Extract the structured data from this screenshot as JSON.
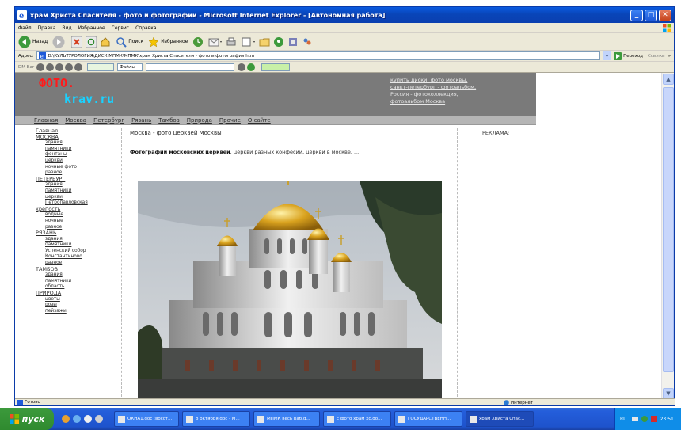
{
  "window": {
    "title": "храм Христа Спасителя - фото и фотографии - Microsoft Internet Explorer - [Автономная работа]",
    "minimize": "_",
    "maximize": "□",
    "close": "✕"
  },
  "menu": [
    "Файл",
    "Правка",
    "Вид",
    "Избранное",
    "Сервис",
    "Справка"
  ],
  "toolbar": {
    "back": "Назад",
    "search": "Поиск",
    "favorites": "Избранное"
  },
  "address": {
    "label": "Адрес:",
    "value": "D:\\КУЛЬТУРОЛОГИЯ\\ДИСК МПМК\\МПМК\\храм Христа Спасителя - фото и фотографии.htm",
    "go": "Переход",
    "links": "Ссылки"
  },
  "linksbar": {
    "label": "DM Bar",
    "files": "Файлы"
  },
  "status": {
    "left": "Готово",
    "zone": "Интернет"
  },
  "site": {
    "logo_top": "ФОТО.",
    "logo_bottom": "krav.ru",
    "header_links": [
      "купить диски: фото москвы,",
      "санкт-петербург - фотоальбом,",
      "Россия - фотоколлекция,",
      "фотоальбом Москва"
    ],
    "nav": [
      "Главная",
      "Москва",
      "Петербург",
      "Рязань",
      "Тамбов",
      "Природа",
      "Прочие",
      "О сайте"
    ],
    "sidebar": [
      {
        "t": "sec",
        "label": "Главная"
      },
      {
        "t": "sec",
        "label": "МОСКВА"
      },
      {
        "t": "sub",
        "label": "здания"
      },
      {
        "t": "sub",
        "label": "памятники"
      },
      {
        "t": "sub",
        "label": "фонтаны"
      },
      {
        "t": "sub",
        "label": "церкви"
      },
      {
        "t": "sub",
        "label": "ночные фото"
      },
      {
        "t": "sub",
        "label": "разное"
      },
      {
        "t": "sec",
        "label": "ПЕТЕРБУРГ"
      },
      {
        "t": "sub",
        "label": "здания"
      },
      {
        "t": "sub",
        "label": "памятники"
      },
      {
        "t": "sub",
        "label": "церкви"
      },
      {
        "t": "sub",
        "label": "Петропавловская"
      },
      {
        "t": "sec",
        "label": "крепость"
      },
      {
        "t": "sub",
        "label": "водные"
      },
      {
        "t": "sub",
        "label": "ночные"
      },
      {
        "t": "sub",
        "label": "разное"
      },
      {
        "t": "sec",
        "label": "РЯЗАНЬ"
      },
      {
        "t": "sub",
        "label": "здания"
      },
      {
        "t": "sub",
        "label": "памятники"
      },
      {
        "t": "sub",
        "label": "Успенский собор"
      },
      {
        "t": "sub",
        "label": "Константиново"
      },
      {
        "t": "sub",
        "label": "разное"
      },
      {
        "t": "sec",
        "label": "ТАМБОВ"
      },
      {
        "t": "sub",
        "label": "здания"
      },
      {
        "t": "sub",
        "label": "памятники"
      },
      {
        "t": "sub",
        "label": "область"
      },
      {
        "t": "sec",
        "label": "ПРИРОДА"
      },
      {
        "t": "sub",
        "label": "цветы"
      },
      {
        "t": "sub",
        "label": "розы"
      },
      {
        "t": "sub",
        "label": "пейзажи"
      }
    ],
    "main_title": "Москва - фото церквей Москвы",
    "main_desc_bold": "Фотографии московских церквей",
    "main_desc_rest": ", церкви разных конфесий, церкви в москве, ...",
    "ad": "РЕКЛАМА:"
  },
  "taskbar": {
    "start": "пуск",
    "tasks": [
      "ОКНА1.doc (восст...",
      "8 октября.doc - M...",
      "МПМК весь раб.d...",
      "с фото храм хс.do...",
      "ГОСУДАРСТВЕНН...",
      "храм Христа Спас..."
    ],
    "lang": "RU",
    "clock": "23:51"
  },
  "colors": {
    "logo_red": "#ff1a1a",
    "logo_cyan": "#1ad1ff",
    "header_gray": "#7a7a7a",
    "nav_gray": "#b5b5b5"
  }
}
